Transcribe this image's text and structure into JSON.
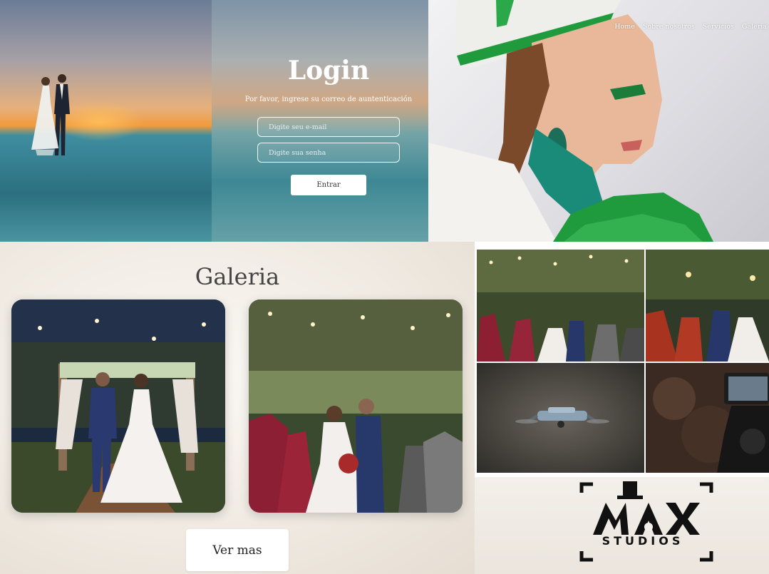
{
  "login": {
    "title": "Login",
    "subtitle": "Por favor, ingrese su correo de auntenticación",
    "email_placeholder": "Digite seu e-mail",
    "password_placeholder": "Digite sua senha",
    "submit_label": "Entrar"
  },
  "nav": {
    "items": [
      {
        "label": "Home"
      },
      {
        "label": "Sobre nosotros"
      },
      {
        "label": "Servicios"
      },
      {
        "label": "Galeria"
      }
    ]
  },
  "gallery": {
    "title": "Galeria",
    "more_label": "Ver mas"
  },
  "logo": {
    "brand": "MAX",
    "subtitle": "STUDIOS"
  },
  "colors": {
    "page_background": "#ece5dc",
    "button_background": "#ffffff",
    "accent_green": "#1f9a3c"
  }
}
